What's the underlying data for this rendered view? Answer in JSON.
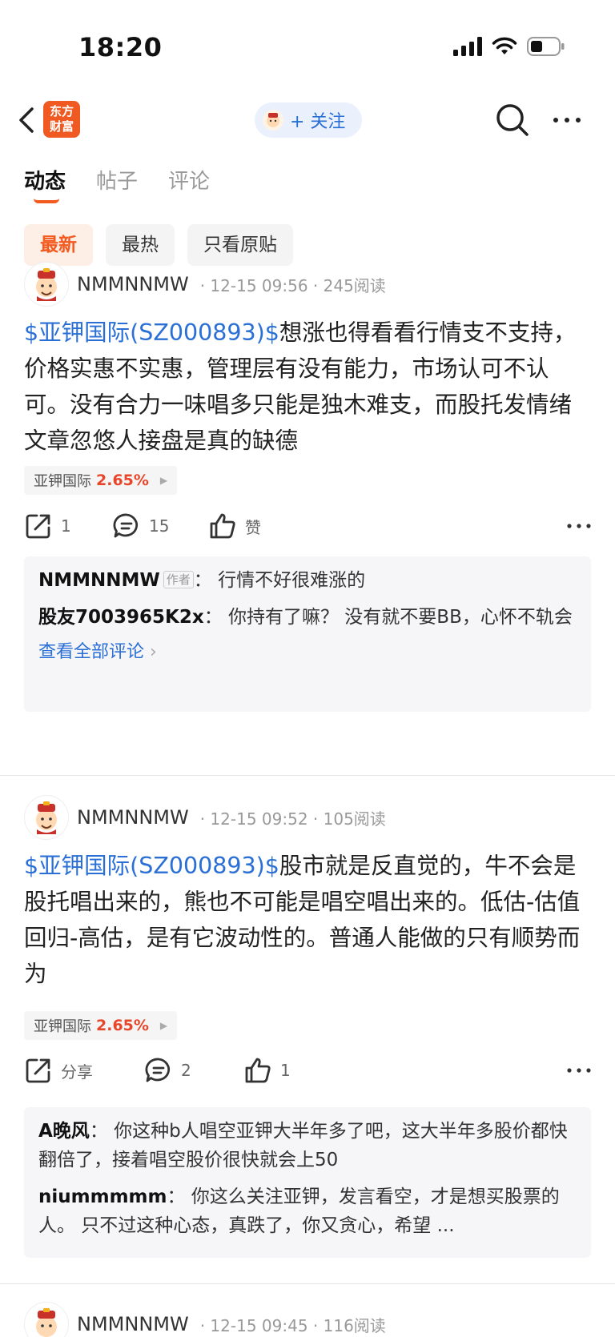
{
  "status_bar": {
    "time": "18:20"
  },
  "nav": {
    "logo_line1": "东方",
    "logo_line2": "财富",
    "follow_label": "+ 关注"
  },
  "tabs": [
    {
      "label": "动态"
    },
    {
      "label": "帖子"
    },
    {
      "label": "评论"
    }
  ],
  "filters": [
    {
      "label": "最新"
    },
    {
      "label": "最热"
    },
    {
      "label": "只看原贴"
    }
  ],
  "posts": [
    {
      "author": "NMMNNMW",
      "meta": "· 12-15 09:56 · 245阅读",
      "stock_tag": "$亚钾国际(SZ000893)$",
      "text": "想涨也得看看行情支不支持，价格实惠不实惠，管理层有没有能力，市场认可不认可。没有合力一味唱多只能是独木难支，而股托发情绪文章忽悠人接盘是真的缺德",
      "stock_name": "亚钾国际",
      "stock_pct": "2.65%",
      "share_label": "1",
      "comment_count": "15",
      "like_label": "赞",
      "comments": [
        {
          "name": "NMMNNMW",
          "badge": "作者",
          "sep": "：",
          "text": "行情不好很难涨的"
        },
        {
          "name": "股友7003965K2x",
          "sep": "：",
          "text": "你持有了嘛？ 没有就不要BB，心怀不轨会"
        }
      ],
      "view_all": "查看全部评论"
    },
    {
      "author": "NMMNNMW",
      "meta": "· 12-15 09:52 · 105阅读",
      "stock_tag": "$亚钾国际(SZ000893)$",
      "text": "股市就是反直觉的，牛不会是股托唱出来的，熊也不可能是唱空唱出来的。低估-估值回归-高估，是有它波动性的。普通人能做的只有顺势而为",
      "stock_name": "亚钾国际",
      "stock_pct": "2.65%",
      "share_label": "分享",
      "comment_count": "2",
      "like_label": "1",
      "comments": [
        {
          "name": "A晚风",
          "sep": "：",
          "text": "你这种b人唱空亚钾大半年多了吧，这大半年多股价都快翻倍了，接着唱空股价很快就会上50"
        },
        {
          "name": "niummmmm",
          "sep": "：",
          "text": "你这么关注亚钾，发言看空，才是想买股票的人。 只不过这种心态，真跌了，你又贪心，希望 ..."
        }
      ]
    },
    {
      "author": "NMMNNMW",
      "meta": "· 12-15 09:45 · 116阅读"
    }
  ]
}
